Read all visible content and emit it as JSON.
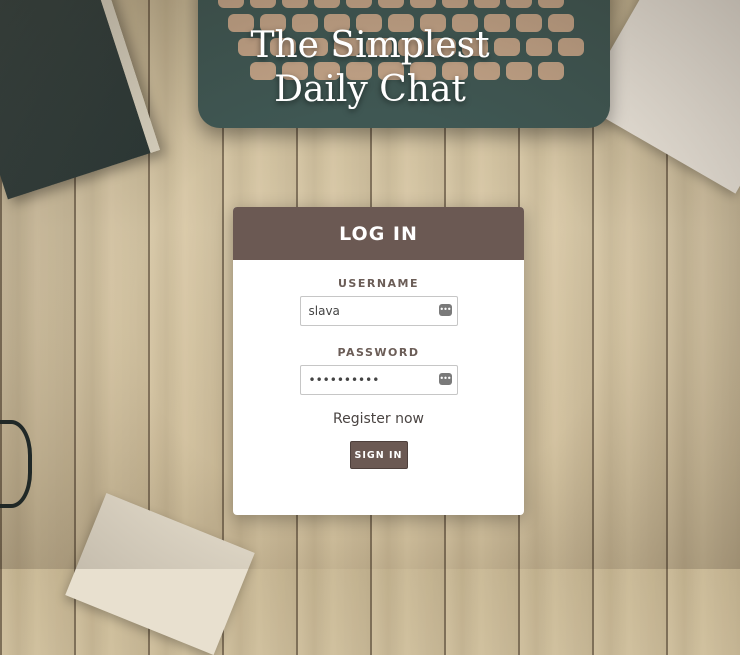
{
  "page": {
    "title_line1": "The Simplest",
    "title_line2": "Daily Chat"
  },
  "login": {
    "header": "LOG IN",
    "username_label": "USERNAME",
    "username_value": "slava",
    "password_label": "PASSWORD",
    "password_value": "••••••••••",
    "register_link": "Register now",
    "signin_button": "SIGN IN"
  },
  "colors": {
    "accent": "#6b5953",
    "background_wood": "#d8c8a6"
  },
  "icons": {
    "field_autofill": "key-dots-icon"
  }
}
